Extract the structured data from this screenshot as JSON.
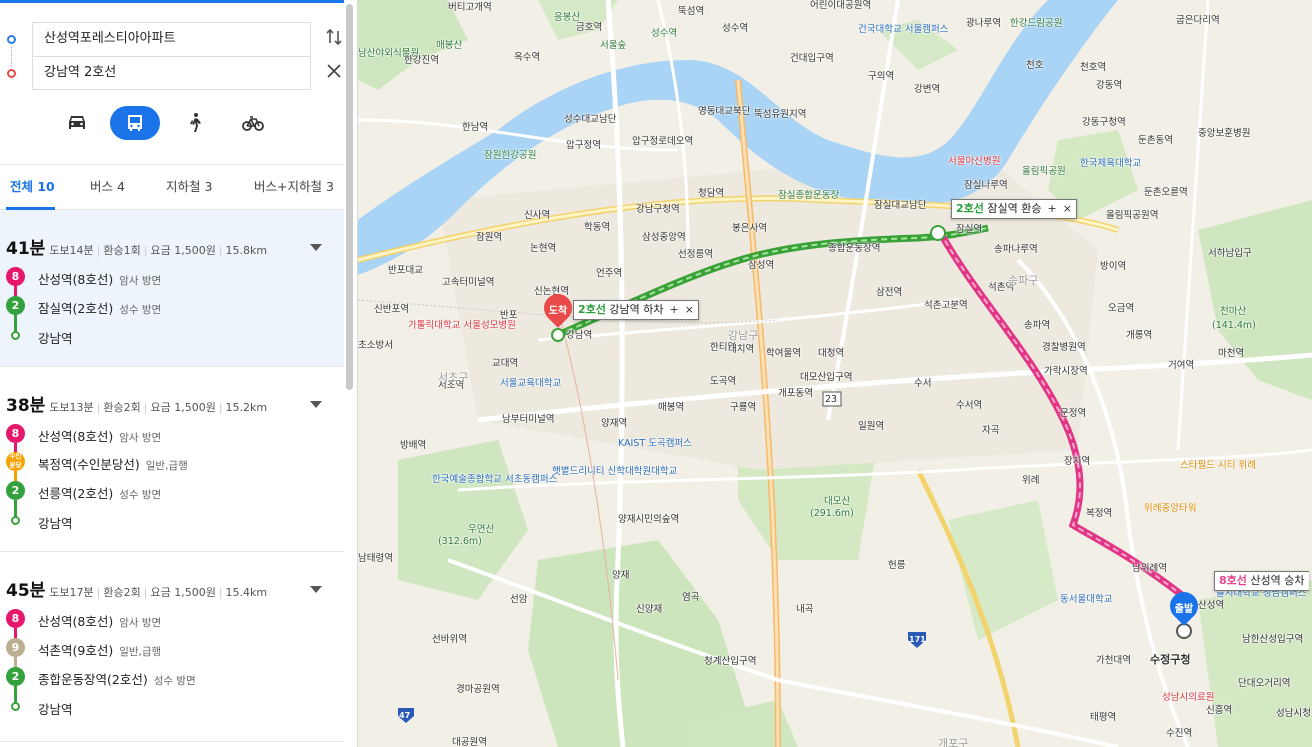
{
  "search": {
    "from": "산성역포레스티아아파트",
    "to": "강남역 2호선"
  },
  "icons": {
    "swap": "swap-vertical-icon",
    "clear": "close-icon",
    "car": "car-icon",
    "bus": "bus-icon",
    "walk": "walk-icon",
    "bike": "bicycle-icon"
  },
  "colors": {
    "accent": "#1a73e8",
    "line2": "#33a23d",
    "line8": "#e6186c",
    "line9": "#bdb092",
    "suin_bundang": "#f5a200"
  },
  "tabs": [
    {
      "label": "전체 10",
      "active": true
    },
    {
      "label": "버스 4"
    },
    {
      "label": "지하철 3"
    },
    {
      "label": "버스+지하철 3"
    }
  ],
  "routes": [
    {
      "time": "41분",
      "walk": "도보14분",
      "transfer": "환승1회",
      "fare": "요금 1,500원",
      "distance": "15.8km",
      "steps": [
        {
          "badge": "8",
          "name": "산성역(8호선)",
          "dir": "암사 방면"
        },
        {
          "badge": "2",
          "name": "잠실역(2호선)",
          "dir": "성수 방면"
        },
        {
          "badge": "",
          "name": "강남역",
          "dir": ""
        }
      ]
    },
    {
      "time": "38분",
      "walk": "도보13분",
      "transfer": "환승2회",
      "fare": "요금 1,500원",
      "distance": "15.2km",
      "steps": [
        {
          "badge": "8",
          "name": "산성역(8호선)",
          "dir": "암사 방면"
        },
        {
          "badge": "수인\n분당",
          "name": "복정역(수인분당선)",
          "dir": "일반,급행"
        },
        {
          "badge": "2",
          "name": "선릉역(2호선)",
          "dir": "성수 방면"
        },
        {
          "badge": "",
          "name": "강남역",
          "dir": ""
        }
      ]
    },
    {
      "time": "45분",
      "walk": "도보17분",
      "transfer": "환승2회",
      "fare": "요금 1,500원",
      "distance": "15.4km",
      "steps": [
        {
          "badge": "8",
          "name": "산성역(8호선)",
          "dir": "암사 방면"
        },
        {
          "badge": "9",
          "name": "석촌역(9호선)",
          "dir": "일반,급행"
        },
        {
          "badge": "2",
          "name": "종합운동장역(2호선)",
          "dir": "성수 방면"
        },
        {
          "badge": "",
          "name": "강남역",
          "dir": ""
        }
      ]
    }
  ],
  "map": {
    "callouts": {
      "transfer": {
        "line": "2호선",
        "text": "잠실역 환승"
      },
      "arrive": {
        "line": "2호선",
        "text": "강남역 하차"
      },
      "depart": {
        "line": "8호선",
        "text": "산성역 승차"
      },
      "plus": "+",
      "close": "×"
    },
    "markers": {
      "arrive": "도착",
      "depart": "출발"
    },
    "labels": [
      "버티고개역",
      "응봉산",
      "매봉산",
      "금호역",
      "옥수역",
      "서울숲",
      "성수역",
      "뚝섬역",
      "성수역",
      "건대입구역",
      "어린이대공원역",
      "건국대학교 서울캠퍼스",
      "구의역",
      "강변역",
      "광나루역",
      "한강드림공원",
      "천호",
      "천호역",
      "굽은다리역",
      "강동역",
      "남산야외식물원",
      "한강진역",
      "압구정역",
      "압구정로데오역",
      "영동대교북단",
      "뚝섬유원지역",
      "성수대교남단",
      "잠원한강공원",
      "한남역",
      "강동구청역",
      "둔촌동역",
      "중앙보훈병원",
      "잠실나루역",
      "올림픽공원",
      "서울아산병원",
      "한국체육대학교",
      "둔촌오륜역",
      "신사역",
      "강남구청역",
      "청담역",
      "잠실종합운동장",
      "잠실대교남단",
      "잠실역",
      "송파나루역",
      "올림픽공원역",
      "잠원역",
      "학동역",
      "삼성중앙역",
      "봉은사역",
      "신논현역",
      "논현역",
      "언주역",
      "선정릉역",
      "삼성역",
      "종합운동장역",
      "방이역",
      "서하남입구",
      "고속터미널역",
      "반포대교",
      "삼전역",
      "석촌고분역",
      "석촌역",
      "오금역",
      "천마산",
      "(141.4m)",
      "개롱역",
      "거여역",
      "마천역",
      "반포",
      "신반포역",
      "가톨릭대학교 서울성모병원",
      "강남역",
      "한티역",
      "대치역",
      "학여울역",
      "대청역",
      "송파역",
      "경찰병원역",
      "가락시장역",
      "초소방서",
      "교대역",
      "서초역",
      "서울교육대학교",
      "도곡역",
      "개포동역",
      "대모산입구역",
      "수서",
      "수서역",
      "문정역",
      "남부터미널역",
      "매봉역",
      "구룡역",
      "일원역",
      "자곡",
      "장지역",
      "위례",
      "스타필드 시티 위례",
      "방배역",
      "양재역",
      "KAIST 도곡캠퍼스",
      "대모산",
      "(291.6m)",
      "복정역",
      "위례중앙타워",
      "한국예술종합학교 서초동캠퍼스",
      "햇볕드리니티 신학대학원대학교",
      "우면산",
      "(312.6m)",
      "양재시민의숲역",
      "남위례역",
      "남태령역",
      "선암",
      "양재",
      "헌릉",
      "동서울대학교",
      "산성역",
      "을지대학교 성남캠퍼스",
      "신양재",
      "염곡",
      "내곡",
      "남한산성입구역",
      "선바위역",
      "청계산입구역",
      "가천대역",
      "수정구청",
      "단대오거리역",
      "경마공원역",
      "성남시의료원",
      "태평역",
      "신흥역",
      "대공원역",
      "수진역",
      "성남시청",
      "송파구",
      "강남구",
      "서초구",
      "개포구"
    ],
    "roads": [
      "23",
      "171",
      "47"
    ]
  }
}
